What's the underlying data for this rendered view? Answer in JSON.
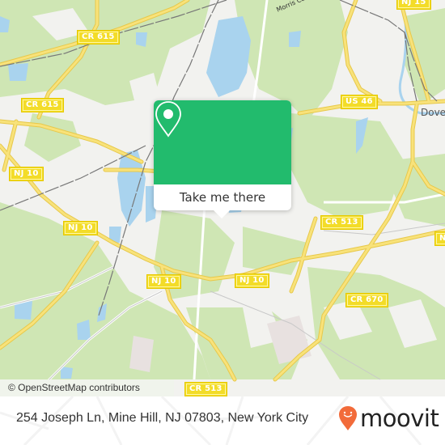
{
  "map": {
    "road_shields": [
      {
        "id": "cr615-top",
        "label": "CR 615"
      },
      {
        "id": "cr615-left",
        "label": "CR 615"
      },
      {
        "id": "nj15",
        "label": "NJ 15"
      },
      {
        "id": "us46",
        "label": "US 46"
      },
      {
        "id": "nj10-left",
        "label": "NJ 10"
      },
      {
        "id": "nj10-mid",
        "label": "NJ 10"
      },
      {
        "id": "nj10-center",
        "label": "NJ 10"
      },
      {
        "id": "nj10-right",
        "label": "NJ 10"
      },
      {
        "id": "cr513-right",
        "label": "CR 513"
      },
      {
        "id": "cr670",
        "label": "CR 670"
      },
      {
        "id": "cr513-bottom",
        "label": "CR 513"
      },
      {
        "id": "edge-right",
        "label": "N"
      }
    ],
    "place_labels": {
      "dover": "Dover",
      "canal": "Morris Canal"
    },
    "attribution": "© OpenStreetMap contributors",
    "colors": {
      "background": "#f2f2ef",
      "forest": "#cfe6b4",
      "water": "#a9d3ee",
      "road": "#f6dd6a",
      "rail": "#777777"
    }
  },
  "popup": {
    "icon": "map-pin-icon",
    "button_label": "Take me there",
    "color": "#22bb6d"
  },
  "footer": {
    "address": "254 Joseph Ln, Mine Hill, NJ 07803, New York City",
    "brand": "moovit",
    "brand_color": "#f26b3a"
  }
}
